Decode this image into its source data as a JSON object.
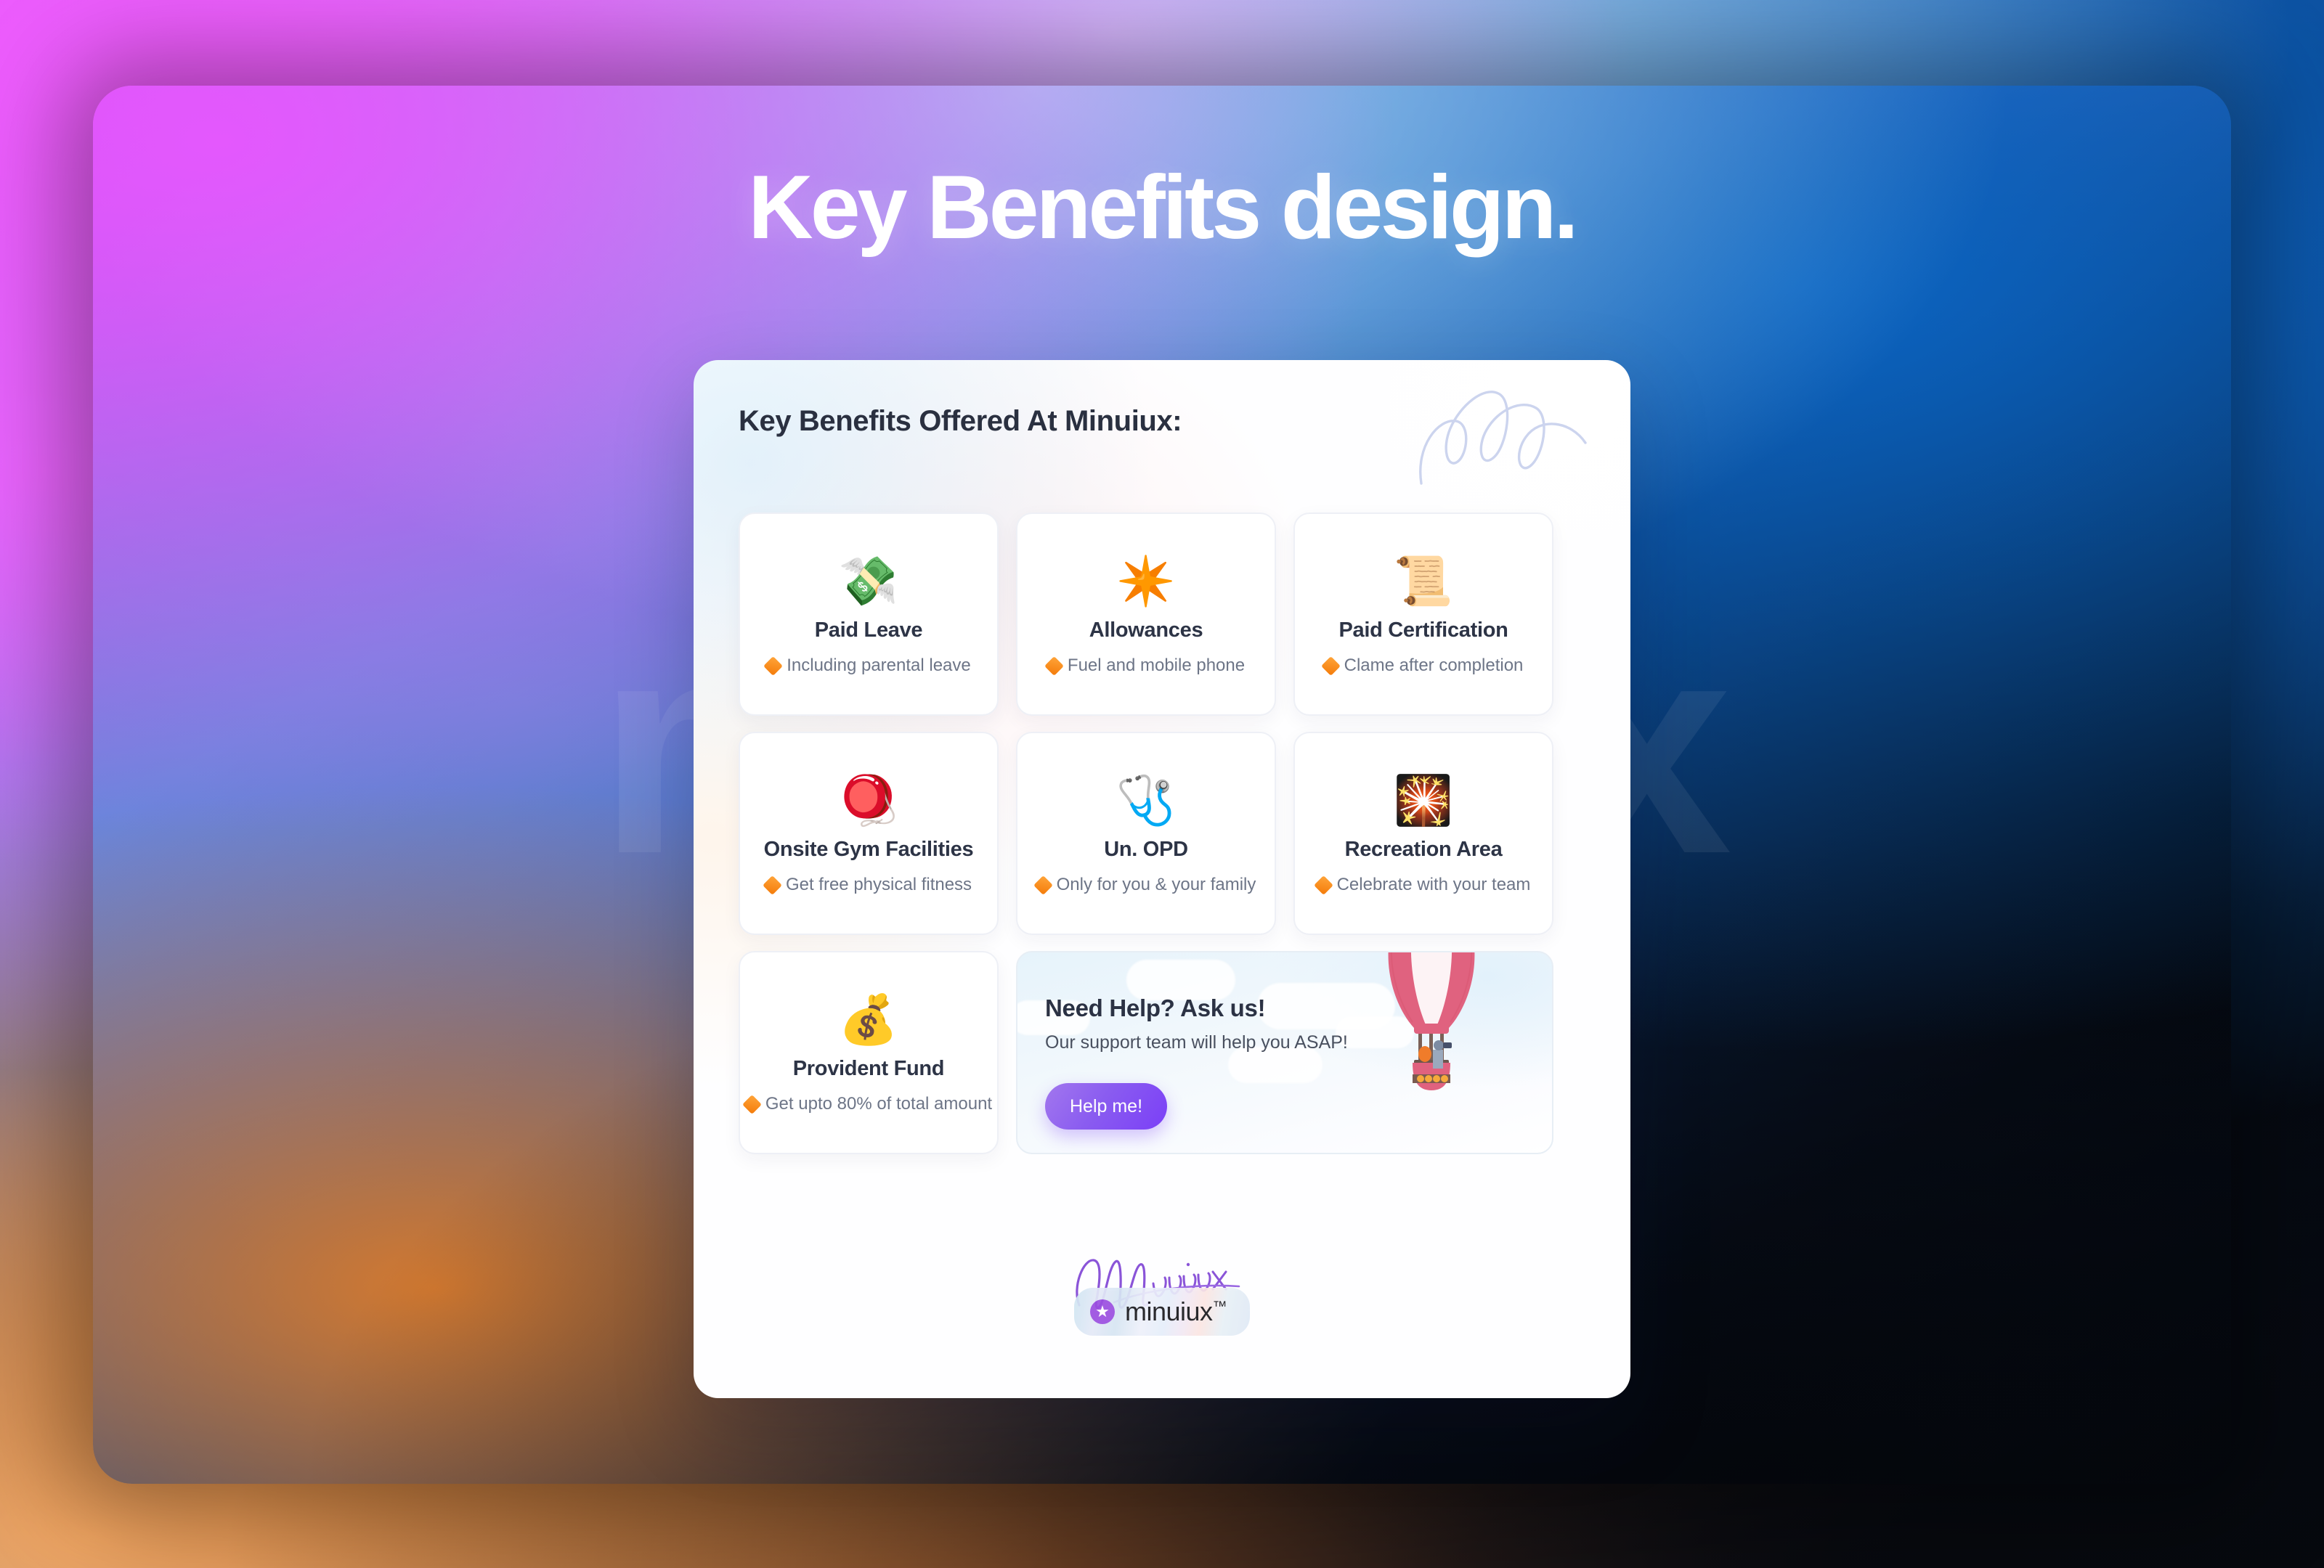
{
  "hero": {
    "title": "Key Benefits design."
  },
  "background": {
    "watermark_text": "minuiux",
    "colors": {
      "magenta": "#e856ff",
      "light_blue": "#b0dbf2",
      "deep_blue": "#0966c6",
      "navy": "#0a2e66",
      "near_black": "#05070c",
      "orange": "#e47e28",
      "peach": "#f6c79a",
      "periwinkle": "#788ade"
    }
  },
  "card": {
    "header": "Key Benefits Offered At Minuiux:",
    "doodle_icon": "scribble-loops-doodle",
    "accent_color": "#f47b09",
    "title_color": "#2a3040"
  },
  "benefits": [
    {
      "icon": "💸",
      "icon_name": "money-with-wings-icon",
      "title": "Paid Leave",
      "subtitle": "Including parental leave"
    },
    {
      "icon": "✴️",
      "icon_name": "eight-pointed-star-icon",
      "title": "Allowances",
      "subtitle": "Fuel and mobile phone"
    },
    {
      "icon": "📜",
      "icon_name": "scroll-icon",
      "title": "Paid Certification",
      "subtitle": "Clame after completion"
    },
    {
      "icon": "🪀",
      "icon_name": "yoyo-icon",
      "title": "Onsite Gym Facilities",
      "subtitle": "Get free physical fitness"
    },
    {
      "icon": "🩺",
      "icon_name": "stethoscope-icon",
      "title": "Un. OPD",
      "subtitle": "Only for you & your family"
    },
    {
      "icon": "🎇",
      "icon_name": "firework-sparkler-icon",
      "title": "Recreation Area",
      "subtitle": "Celebrate with your team"
    },
    {
      "icon": "💰",
      "icon_name": "money-bag-icon",
      "title": "Provident Fund",
      "subtitle": "Get upto 80% of total amount"
    }
  ],
  "help_banner": {
    "title": "Need Help? Ask us!",
    "subtitle": "Our support team will help you ASAP!",
    "button_label": "Help me!",
    "button_gradient_from": "#a277ee",
    "button_gradient_to": "#7b3ff7",
    "illustration": "hot-air-balloon-illustration",
    "balloon_color": "#e0627f"
  },
  "footer": {
    "signature_text": "Minuiux",
    "logo_star": "★",
    "logo_text": "minuiux",
    "logo_tm": "™"
  }
}
